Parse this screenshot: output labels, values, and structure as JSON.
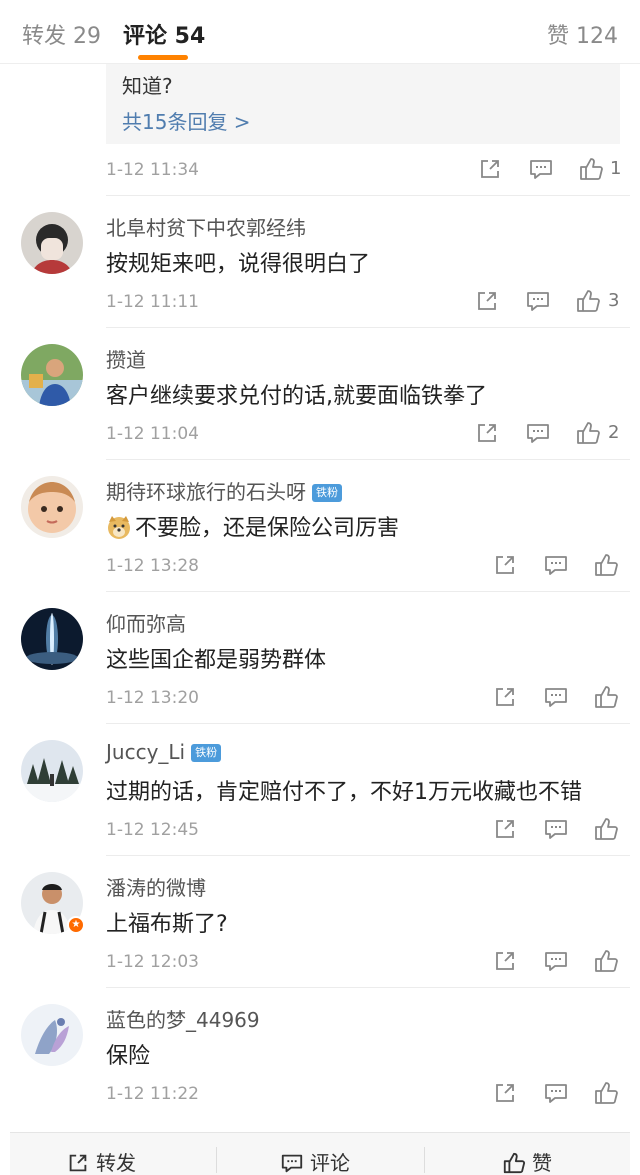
{
  "tabs": {
    "repost": "转发 29",
    "comment": "评论 54",
    "like": "赞 124"
  },
  "first": {
    "reply_text": "知道?",
    "reply_more": "共15条回复 >",
    "time": "1-12 11:34",
    "likes": "1"
  },
  "comments": [
    {
      "user": "北阜村贫下中农郭经纬",
      "badge": "",
      "text": "按规矩来吧，说得很明白了",
      "time": "1-12 11:11",
      "likes": "3"
    },
    {
      "user": "攒道",
      "badge": "",
      "text": "客户继续要求兑付的话,就要面临铁拳了",
      "time": "1-12 11:04",
      "likes": "2"
    },
    {
      "user": "期待环球旅行的石头呀",
      "badge": "铁粉",
      "text": "不要脸，还是保险公司厉害",
      "time": "1-12 13:28",
      "likes": ""
    },
    {
      "user": "仰而弥高",
      "badge": "",
      "text": "这些国企都是弱势群体",
      "time": "1-12 13:20",
      "likes": ""
    },
    {
      "user": "Juccy_Li",
      "badge": "铁粉",
      "text": "过期的话，肯定赔付不了，不好1万元收藏也不错",
      "time": "1-12 12:45",
      "likes": ""
    },
    {
      "user": "潘涛的微博",
      "badge": "",
      "text": "上福布斯了?",
      "time": "1-12 12:03",
      "likes": ""
    },
    {
      "user": "蓝色的梦_44969",
      "badge": "",
      "text": "保险",
      "time": "1-12 11:22",
      "likes": ""
    }
  ],
  "bottom": {
    "repost": "转发",
    "comment": "评论",
    "like": "赞"
  },
  "icons": {
    "share": "share-icon",
    "comment": "comment-icon",
    "like": "thumbs-up-icon",
    "emoji": "doge-emoji-icon"
  },
  "colors": {
    "accent": "#ff8200",
    "link": "#507daf",
    "fan_badge": "#4c9bdb"
  }
}
